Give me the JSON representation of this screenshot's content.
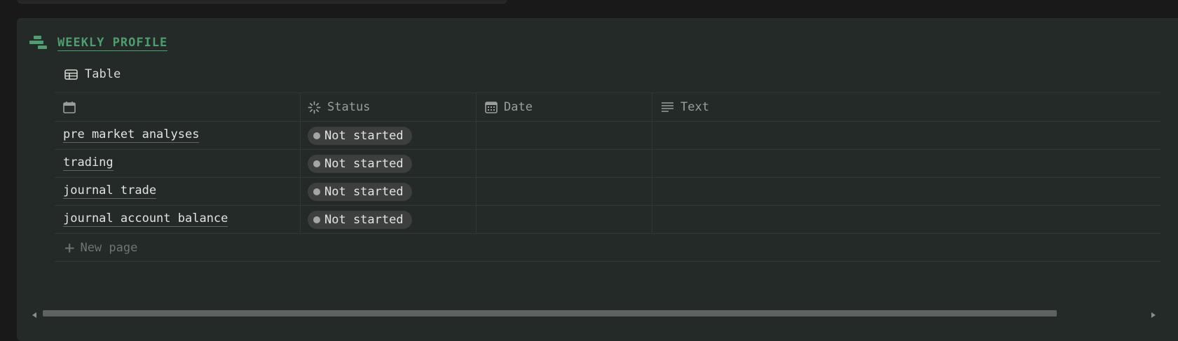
{
  "section": {
    "title": "WEEKLY PROFILE",
    "icon": "stairs-icon",
    "accent_color": "#4f9e6f"
  },
  "view": {
    "label": "Table",
    "icon": "table-icon"
  },
  "columns": [
    {
      "label": "",
      "icon": "calendar-icon"
    },
    {
      "label": "Status",
      "icon": "status-loader-icon"
    },
    {
      "label": "Date",
      "icon": "date-icon"
    },
    {
      "label": "Text",
      "icon": "text-lines-icon"
    }
  ],
  "rows": [
    {
      "name": "pre market analyses",
      "status": "Not started",
      "date": "",
      "text": ""
    },
    {
      "name": "trading",
      "status": "Not started",
      "date": "",
      "text": ""
    },
    {
      "name": "journal trade",
      "status": "Not started",
      "date": "",
      "text": ""
    },
    {
      "name": "journal account balance",
      "status": "Not started",
      "date": "",
      "text": ""
    }
  ],
  "new_page": {
    "label": "New page",
    "icon": "plus-icon"
  },
  "colors": {
    "background": "#191919",
    "card": "#232a27",
    "status_pill": "#3c3f3d"
  }
}
